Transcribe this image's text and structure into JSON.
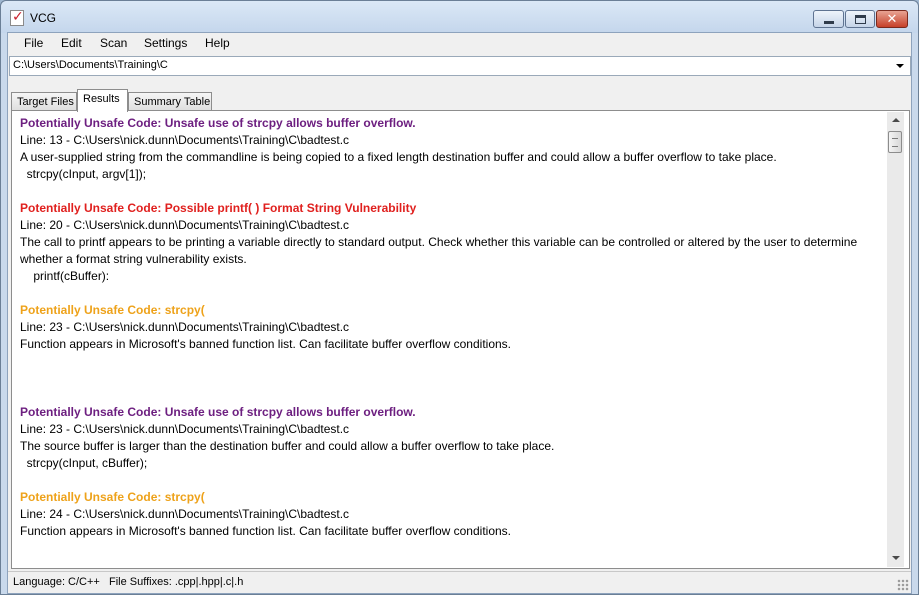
{
  "window": {
    "title": "VCG"
  },
  "menu": [
    "File",
    "Edit",
    "Scan",
    "Settings",
    "Help"
  ],
  "path": {
    "value": "C:\\Users\\Documents\\Training\\C"
  },
  "tabs": [
    {
      "label": "Target Files",
      "active": false
    },
    {
      "label": "Results",
      "active": true
    },
    {
      "label": "Summary Table",
      "active": false
    }
  ],
  "colors": {
    "purple": "#6d1f80",
    "red": "#e0201e",
    "orange": "#eea21a"
  },
  "results": [
    {
      "title": "Potentially Unsafe Code: Unsafe use of strcpy allows buffer overflow.",
      "color": "#6d1f80",
      "line": "Line: 13 - C:\\Users\\nick.dunn\\Documents\\Training\\C\\badtest.c",
      "desc": "A user-supplied string from the commandline is being copied to a fixed length destination buffer and could allow a buffer overflow to take place.",
      "code": "  strcpy(cInput, argv[1]);"
    },
    {
      "title": "Potentially Unsafe Code: Possible printf( ) Format String Vulnerability",
      "color": "#e0201e",
      "line": "Line: 20 - C:\\Users\\nick.dunn\\Documents\\Training\\C\\badtest.c",
      "desc": "The call to printf appears to be printing a variable directly to standard output. Check whether this variable can be controlled or altered by the user to determine whether a format string vulnerability exists.",
      "code": "    printf(cBuffer):"
    },
    {
      "title": "Potentially Unsafe Code: strcpy(",
      "color": "#eea21a",
      "line": "Line: 23 - C:\\Users\\nick.dunn\\Documents\\Training\\C\\badtest.c",
      "desc": "Function appears in Microsoft's banned function list. Can facilitate buffer overflow conditions.",
      "code": " "
    },
    {
      "title": "Potentially Unsafe Code: Unsafe use of strcpy allows buffer overflow.",
      "color": "#6d1f80",
      "line": "Line: 23 - C:\\Users\\nick.dunn\\Documents\\Training\\C\\badtest.c",
      "desc": "The source buffer is larger than the destination buffer and could allow a buffer overflow to take place.",
      "code": "  strcpy(cInput, cBuffer);"
    },
    {
      "title": "Potentially Unsafe Code: strcpy(",
      "color": "#eea21a",
      "line": "Line: 24 - C:\\Users\\nick.dunn\\Documents\\Training\\C\\badtest.c",
      "desc": "Function appears in Microsoft's banned function list. Can facilitate buffer overflow conditions.",
      "code": ""
    }
  ],
  "status": {
    "text": "Language: C/C++   File Suffixes: .cpp|.hpp|.c|.h"
  }
}
